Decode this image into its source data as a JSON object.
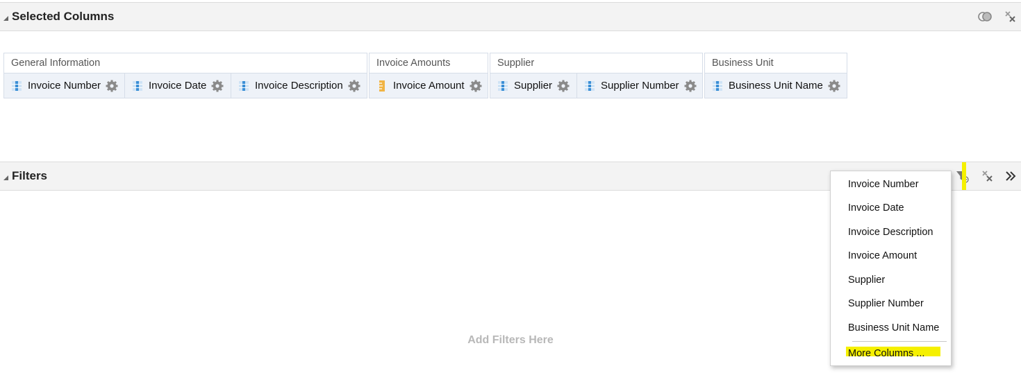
{
  "selected_columns": {
    "title": "Selected Columns",
    "groups": [
      {
        "title": "General Information",
        "columns": [
          "Invoice Number",
          "Invoice Date",
          "Invoice Description"
        ]
      },
      {
        "title": "Invoice Amounts",
        "columns": [
          "Invoice Amount"
        ]
      },
      {
        "title": "Supplier",
        "columns": [
          "Supplier",
          "Supplier Number"
        ]
      },
      {
        "title": "Business Unit",
        "columns": [
          "Business Unit Name"
        ]
      }
    ]
  },
  "filters": {
    "title": "Filters",
    "empty_text": "Add Filters Here"
  },
  "menu": {
    "items": [
      "Invoice Number",
      "Invoice Date",
      "Invoice Description",
      "Invoice Amount",
      "Supplier",
      "Supplier Number",
      "Business Unit Name"
    ],
    "more": "More Columns ..."
  },
  "colors": {
    "highlight": "#f5f000",
    "column_icon_blue": "#3b8fd6",
    "measure_icon_orange": "#f0b445"
  }
}
